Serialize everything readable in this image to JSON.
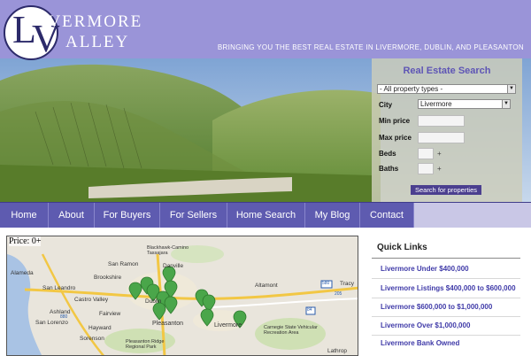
{
  "header": {
    "logo_top": "IVERMORE",
    "logo_bottom": "ALLEY",
    "logo_L": "L",
    "logo_V": "V",
    "tagline": "BRINGING YOU THE BEST REAL ESTATE IN LIVERMORE, DUBLIN, AND PLEASANTON"
  },
  "search": {
    "title": "Real Estate Search",
    "property_type": "- All property types -",
    "city_label": "City",
    "city_value": "Livermore",
    "min_price_label": "Min price",
    "max_price_label": "Max price",
    "beds_label": "Beds",
    "baths_label": "Baths",
    "plus": "+",
    "button": "Search for properties"
  },
  "nav": {
    "items": [
      "Home",
      "About",
      "For Buyers",
      "For Sellers",
      "Home Search",
      "My Blog",
      "Contact"
    ]
  },
  "map": {
    "price_label": "Price: 0+",
    "places": [
      "Alameda",
      "San Ramon",
      "Blackhawk-Camino Tassajara",
      "Brookshire",
      "Danville",
      "San Leandro",
      "Castro Valley",
      "Ashland",
      "Dublin",
      "Altamont",
      "Tracy",
      "San Lorenzo",
      "Fairview",
      "Hayward",
      "Sorenson",
      "Pleasanton",
      "Livermore",
      "Pleasanton Ridge Regional Park",
      "Carnegie State Vehicular Recreation Area",
      "Lathrop"
    ],
    "highways": [
      "580",
      "880",
      "84",
      "205"
    ]
  },
  "quick_links": {
    "title": "Quick Links",
    "items": [
      "Livermore Under $400,000",
      "Livermore Listings $400,000 to $600,000",
      "Livermore $600,000 to $1,000,000",
      "Livermore Over $1,000,000",
      "Livermore Bank Owned"
    ]
  },
  "colors": {
    "header": "#9a94d8",
    "nav": "#5e5bb0",
    "link": "#3f3aa8",
    "search_title": "#5e55b5",
    "pin": "#4aa64a"
  }
}
